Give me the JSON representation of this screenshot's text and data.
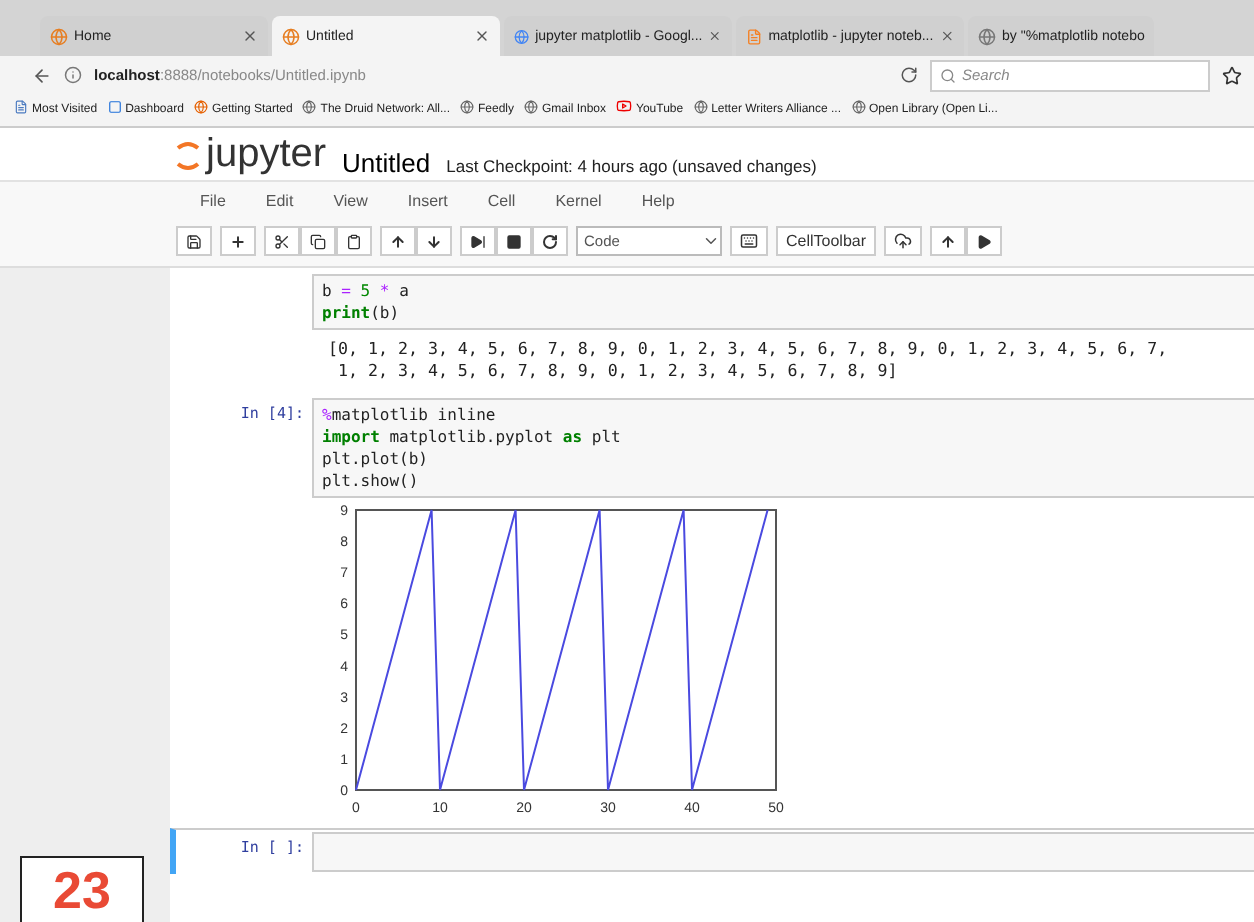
{
  "browser": {
    "tabs": [
      {
        "label": "Home",
        "selected": false
      },
      {
        "label": "Untitled",
        "selected": true
      },
      {
        "label": "jupyter matplotlib - Googl...",
        "selected": false
      },
      {
        "label": "matplotlib - jupyter noteb...",
        "selected": false
      },
      {
        "label": "by \"%matplotlib notebo",
        "selected": false
      }
    ],
    "address": {
      "host": "localhost",
      "path": ":8888/notebooks/Untitled.ipynb"
    },
    "search": {
      "placeholder": "Search"
    },
    "bookmarks": [
      "Most Visited",
      "Dashboard",
      "Getting Started",
      "The Druid Network: All...",
      "Feedly",
      "Gmail Inbox",
      "YouTube",
      "Letter Writers Alliance ...",
      "Open Library (Open Li..."
    ]
  },
  "notebook": {
    "logo": "jupyter",
    "title": "Untitled",
    "checkpoint": "Last Checkpoint: 4 hours ago (unsaved changes)",
    "menu": [
      "File",
      "Edit",
      "View",
      "Insert",
      "Cell",
      "Kernel",
      "Help"
    ],
    "cell_type": "Code",
    "cell_toolbar": "CellToolbar",
    "cells": [
      {
        "selected": false,
        "lines": [
          [
            {
              "text": "b ",
              "kind": "plain"
            },
            {
              "text": "=",
              "kind": "op"
            },
            {
              "text": " 5",
              "kind": "num"
            },
            {
              "text": " *",
              "kind": "op"
            },
            {
              "text": " a",
              "kind": "plain"
            }
          ],
          [
            {
              "text": "print",
              "kind": "kw"
            },
            {
              "text": "(b)",
              "kind": "plain"
            }
          ]
        ],
        "output_text": [
          "[0, 1, 2, 3, 4, 5, 6, 7, 8, 9, 0, 1, 2, 3, 4, 5, 6, 7, 8, 9, 0, 1, 2, 3, 4, 5, 6, 7,",
          " 1, 2, 3, 4, 5, 6, 7, 8, 9, 0, 1, 2, 3, 4, 5, 6, 7, 8, 9]"
        ]
      },
      {
        "prompt": "In [4]:",
        "selected": false,
        "lines": [
          [
            {
              "text": "%",
              "kind": "magic"
            },
            {
              "text": "matplotlib inline",
              "kind": "plain"
            }
          ],
          [
            {
              "text": "import",
              "kind": "kw"
            },
            {
              "text": " matplotlib.pyplot ",
              "kind": "plain"
            },
            {
              "text": "as",
              "kind": "kw"
            },
            {
              "text": " plt",
              "kind": "plain"
            }
          ],
          [
            {
              "text": "plt.plot(b)",
              "kind": "plain"
            }
          ],
          [
            {
              "text": "plt.show()",
              "kind": "plain"
            }
          ]
        ],
        "chart_data": {
          "type": "line",
          "x": [
            0,
            1,
            2,
            3,
            4,
            5,
            6,
            7,
            8,
            9,
            10,
            11,
            12,
            13,
            14,
            15,
            16,
            17,
            18,
            19,
            20,
            21,
            22,
            23,
            24,
            25,
            26,
            27,
            28,
            29,
            30,
            31,
            32,
            33,
            34,
            35,
            36,
            37,
            38,
            39,
            40,
            41,
            42,
            43,
            44,
            45,
            46,
            47,
            48,
            49
          ],
          "series": [
            {
              "color": "#4a4ae0",
              "values": [
                0,
                1,
                2,
                3,
                4,
                5,
                6,
                7,
                8,
                9,
                0,
                1,
                2,
                3,
                4,
                5,
                6,
                7,
                8,
                9,
                0,
                1,
                2,
                3,
                4,
                5,
                6,
                7,
                8,
                9,
                0,
                1,
                2,
                3,
                4,
                5,
                6,
                7,
                8,
                9,
                0,
                1,
                2,
                3,
                4,
                5,
                6,
                7,
                8,
                9
              ]
            }
          ],
          "xlim": [
            0,
            50
          ],
          "ylim": [
            0,
            9
          ],
          "xticks": [
            0,
            10,
            20,
            30,
            40,
            50
          ],
          "yticks": [
            0,
            1,
            2,
            3,
            4,
            5,
            6,
            7,
            8,
            9
          ]
        }
      },
      {
        "prompt": "In [ ]:",
        "selected": true
      }
    ]
  },
  "page_number": "23"
}
